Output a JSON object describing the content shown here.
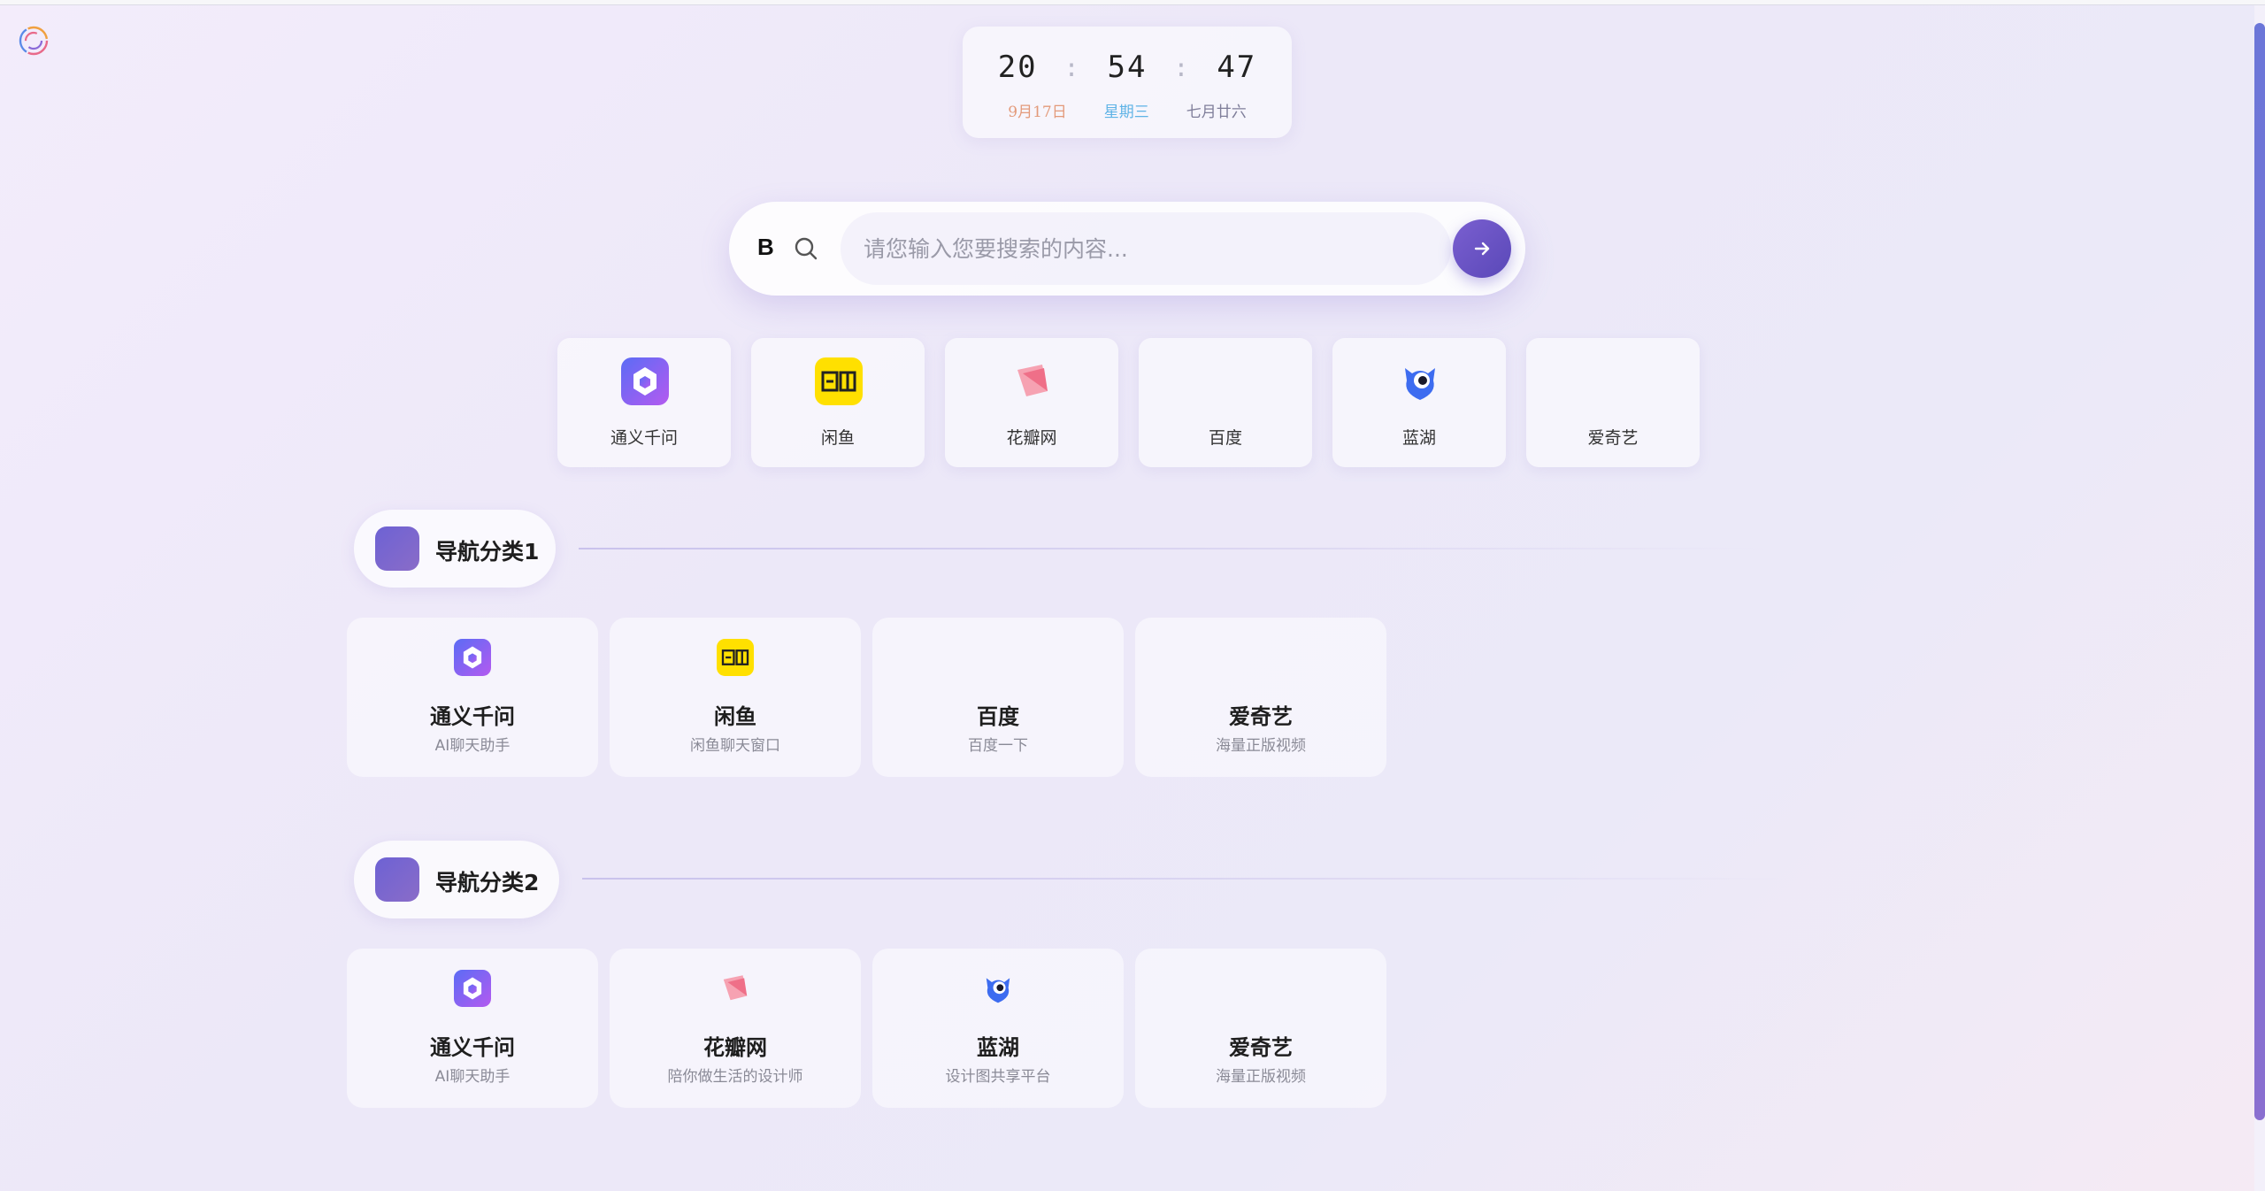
{
  "clock": {
    "hours": "20",
    "minutes": "54",
    "seconds": "47",
    "separator": ":",
    "date": "9月17日",
    "weekday": "星期三",
    "lunar": "七月廿六"
  },
  "search": {
    "engine_label": "B",
    "placeholder": "请您输入您要搜索的内容..."
  },
  "quick_links": [
    {
      "label": "通义千问",
      "icon": "tongyi-icon"
    },
    {
      "label": "闲鱼",
      "icon": "xianyu-icon"
    },
    {
      "label": "花瓣网",
      "icon": "huaban-icon"
    },
    {
      "label": "百度",
      "icon": "baidu-icon"
    },
    {
      "label": "蓝湖",
      "icon": "lanhu-icon"
    },
    {
      "label": "爱奇艺",
      "icon": "iqiyi-icon"
    }
  ],
  "categories": [
    {
      "title": "导航分类1",
      "items": [
        {
          "title": "通义千问",
          "desc": "AI聊天助手",
          "icon": "tongyi-icon"
        },
        {
          "title": "闲鱼",
          "desc": "闲鱼聊天窗口",
          "icon": "xianyu-icon"
        },
        {
          "title": "百度",
          "desc": "百度一下",
          "icon": "baidu-icon"
        },
        {
          "title": "爱奇艺",
          "desc": "海量正版视频",
          "icon": "iqiyi-icon"
        }
      ]
    },
    {
      "title": "导航分类2",
      "items": [
        {
          "title": "通义千问",
          "desc": "AI聊天助手",
          "icon": "tongyi-icon"
        },
        {
          "title": "花瓣网",
          "desc": "陪你做生活的设计师",
          "icon": "huaban-icon"
        },
        {
          "title": "蓝湖",
          "desc": "设计图共享平台",
          "icon": "lanhu-icon"
        },
        {
          "title": "爱奇艺",
          "desc": "海量正版视频",
          "icon": "iqiyi-icon"
        }
      ]
    }
  ],
  "colors": {
    "accent": "#6d5ad0",
    "date": "#e39a7a",
    "weekday": "#5fb3e6",
    "lunar": "#7f7e9a"
  }
}
